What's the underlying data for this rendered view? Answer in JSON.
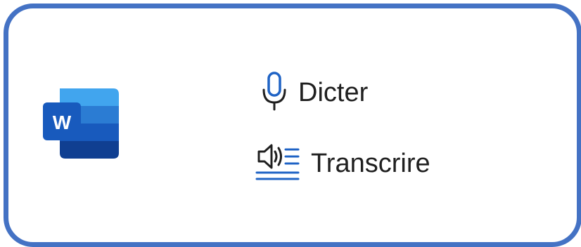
{
  "app": {
    "name": "Word",
    "logo_letter": "W",
    "logo_icon": "microsoft-word-icon"
  },
  "menu": {
    "items": [
      {
        "label": "Dicter",
        "icon": "microphone-icon"
      },
      {
        "label": "Transcrire",
        "icon": "transcribe-icon"
      }
    ]
  },
  "colors": {
    "frame_border": "#4472c4",
    "icon_blue": "#1f63c5",
    "word_dark": "#185abd",
    "word_mid": "#2b7cd3",
    "word_light": "#41a5ee"
  }
}
